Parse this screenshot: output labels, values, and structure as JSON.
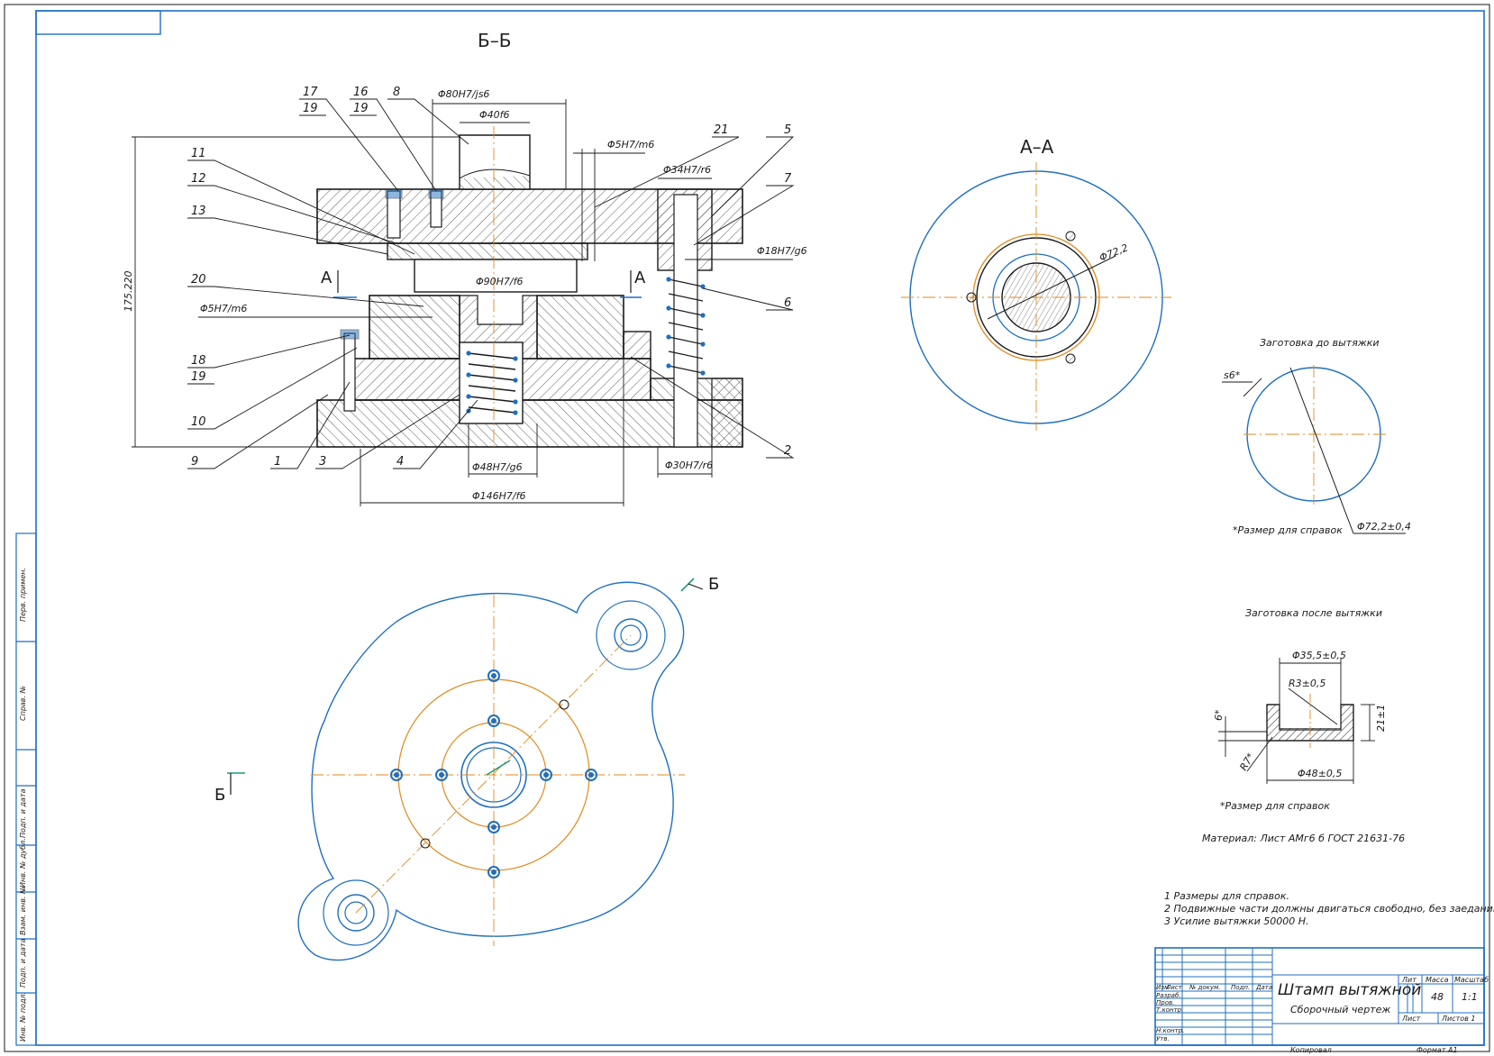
{
  "section_bb": "Б–Б",
  "section_aa": "А–А",
  "cut_a": "А",
  "cut_b": "Б",
  "dims": {
    "d80": "Φ80H7/js6",
    "d40": "Φ40f6",
    "d5_top": "Φ5H7/m6",
    "d34": "Φ34H7/r6",
    "d18": "Φ18H7/g6",
    "d90": "Φ90H7/f6",
    "d5_left": "Φ5H7/m6",
    "d48": "Φ48H7/g6",
    "d30": "Φ30H7/r6",
    "d146": "Φ146H7/f6",
    "height": "175.220",
    "d72": "Φ72,2"
  },
  "positions": [
    "17",
    "19",
    "16",
    "19",
    "8",
    "21",
    "5",
    "7",
    "11",
    "12",
    "13",
    "6",
    "20",
    "18",
    "19",
    "10",
    "9",
    "1",
    "3",
    "4",
    "2"
  ],
  "blank_before": {
    "title": "Заготовка до вытяжки",
    "thickness": "s6*",
    "diameter": "Φ72,2±0,4",
    "note": "*Размер для справок"
  },
  "blank_after": {
    "title": "Заготовка после вытяжки",
    "d_inner": "Φ35,5±0,5",
    "radius_in": "R3±0,5",
    "height": "21±1",
    "thick": "6*",
    "radius_out": "R7*",
    "d_outer": "Φ48±0,5",
    "note": "*Размер для справок"
  },
  "material": "Материал: Лист АМг6 б ГОСТ 21631-76",
  "notes": [
    "1 Размеры для справок.",
    "2 Подвижные части должны двигаться свободно, без заеданий.",
    "3 Усилие вытяжки 50000 Н."
  ],
  "stamp": {
    "title": "Штамп вытяжной",
    "subtitle": "Сборочный чертеж",
    "lit": "Лит",
    "mass_label": "Масса",
    "scale_label": "Масштаб",
    "mass": "48",
    "scale": "1:1",
    "sheet": "Лист",
    "sheets": "Листов  1",
    "copied": "Копировал",
    "format": "Формат     А1",
    "row_labels": [
      "Разраб.",
      "Пров.",
      "Т.контр.",
      "",
      "Н.контр.",
      "Утв."
    ],
    "col_labels": [
      "Изм",
      "Лист",
      "№ докум.",
      "Подп.",
      "Дата"
    ]
  },
  "side_labels": [
    "Перв. примен.",
    "Справ. №",
    "Подп. и дата",
    "Инв. № дубл.",
    "Взам. инв. №",
    "Подп. и дата",
    "Инв. № подл."
  ],
  "colors": {
    "frame": "#1f6fc0",
    "center": "#e08a1e",
    "line": "#1a1a1a",
    "hatch": "#333333"
  }
}
